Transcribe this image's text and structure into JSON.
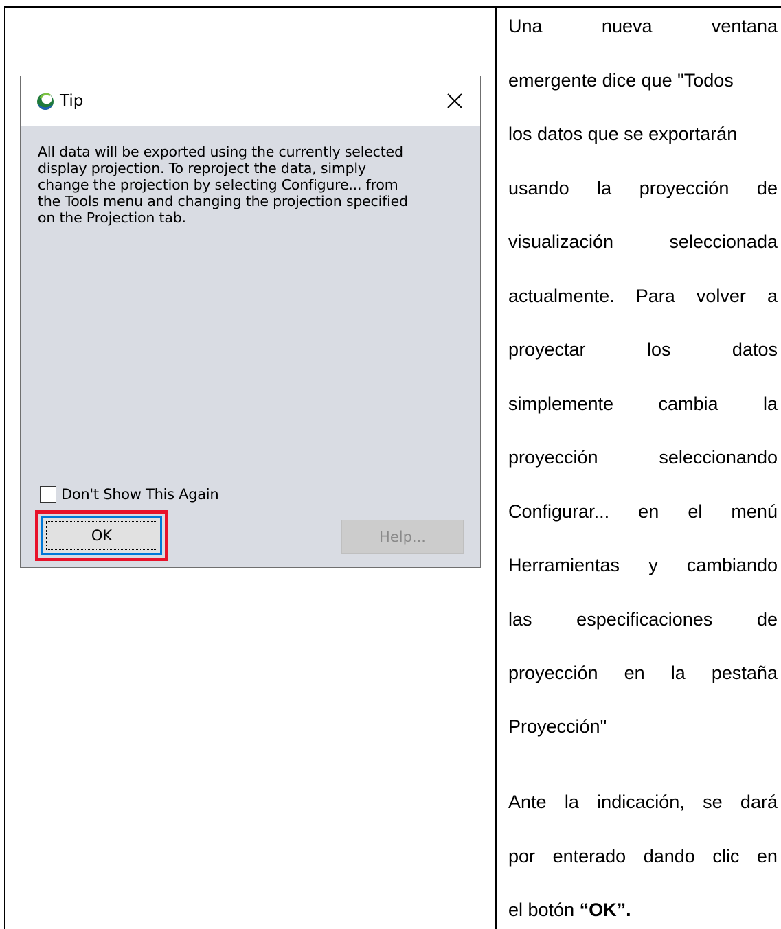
{
  "dialog": {
    "title": "Tip",
    "close_glyph": "✕",
    "message_lines": [
      "All data will be exported using the currently selected",
      "display projection. To reproject the data, simply",
      "change the projection by selecting Configure... from",
      "the Tools menu and changing the projection specified",
      "on the Projection tab."
    ],
    "checkbox_label": "Don't Show This Again",
    "checkbox_checked": false,
    "ok_label": "OK",
    "help_label": "Help...",
    "help_enabled": false,
    "icons": {
      "app": "app-logo-icon",
      "close": "close-icon"
    },
    "colors": {
      "highlight": "#e8122a",
      "focus": "#0078d7",
      "body": "#d9dce3"
    }
  },
  "description": {
    "lines": [
      [
        "Una",
        "nueva",
        "ventana"
      ],
      [
        "emergente dice que \"Todos"
      ],
      [
        "los datos que se exportarán"
      ],
      [
        "usando",
        "la",
        "proyección",
        "de"
      ],
      [
        "visualización",
        "seleccionada"
      ],
      [
        "actualmente.",
        "Para",
        "volver",
        "a"
      ],
      [
        "proyectar",
        "los",
        "datos"
      ],
      [
        "simplemente",
        "cambia",
        "la"
      ],
      [
        "proyección",
        "seleccionando"
      ],
      [
        "Configurar...",
        "en",
        "el",
        "menú"
      ],
      [
        "Herramientas",
        "y",
        "cambiando"
      ],
      [
        "las",
        "especificaciones",
        "de"
      ],
      [
        "proyección",
        "en",
        "la",
        "pestaña"
      ],
      [
        "Proyección\""
      ]
    ],
    "instruction_lines": [
      [
        "Ante",
        "la",
        "indicación,",
        "se",
        "dará"
      ],
      [
        "por",
        "enterado",
        "dando",
        "clic",
        "en"
      ]
    ],
    "final_prefix": "el botón ",
    "final_bold": "“OK”."
  }
}
